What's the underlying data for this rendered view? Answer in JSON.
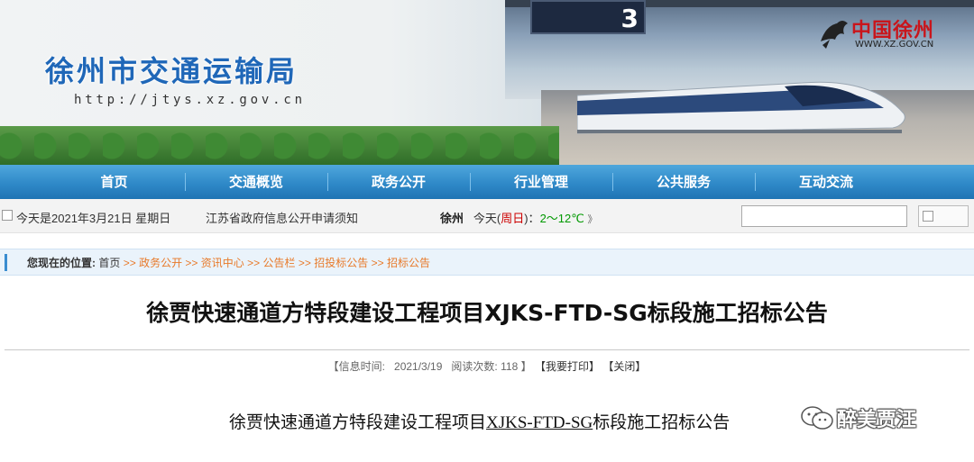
{
  "header": {
    "site_title": "徐州市交通运输局",
    "site_url": "http://jtys.xz.gov.cn",
    "logo_text": "中国徐州",
    "logo_url": "WWW.XZ.GOV.CN",
    "platform_sign_number": "3"
  },
  "nav": {
    "items": [
      {
        "label": "首页"
      },
      {
        "label": "交通概览"
      },
      {
        "label": "政务公开"
      },
      {
        "label": "行业管理"
      },
      {
        "label": "公共服务"
      },
      {
        "label": "互动交流"
      }
    ]
  },
  "infobar": {
    "date": "今天是2021年3月21日  星期日",
    "notice": "江苏省政府信息公开申请须知",
    "city": "徐州",
    "today": "今天(",
    "weekday": "周日",
    "close_paren": ")：",
    "temp": "2～12℃",
    "arrows": "》",
    "search_value": ""
  },
  "breadcrumb": {
    "label": "您现在的位置:",
    "home": "首页",
    "sep": ">>",
    "links": [
      "政务公开",
      "资讯中心",
      "公告栏",
      "招投标公告",
      "招标公告"
    ]
  },
  "article": {
    "title": "徐贾快速通道方特段建设工程项目XJKS-FTD-SG标段施工招标公告",
    "meta_info_label": "【信息时间:",
    "meta_date": "2021/3/19",
    "meta_views_label": "阅读次数:",
    "meta_views": "118",
    "meta_close_bracket": "】",
    "print_label": "【我要打印】",
    "close_label": "【关闭】",
    "body_prefix": "徐贾快速通道方特段建设工程项目",
    "body_code": "XJKS-FTD-SG",
    "body_suffix": "标段施工招标公告"
  },
  "watermark": {
    "text": "醉美贾汪"
  },
  "colors": {
    "nav_blue": "#2f89c8",
    "title_blue": "#1f67b8",
    "link_orange": "#e87a2a",
    "logo_red": "#c9151b"
  }
}
